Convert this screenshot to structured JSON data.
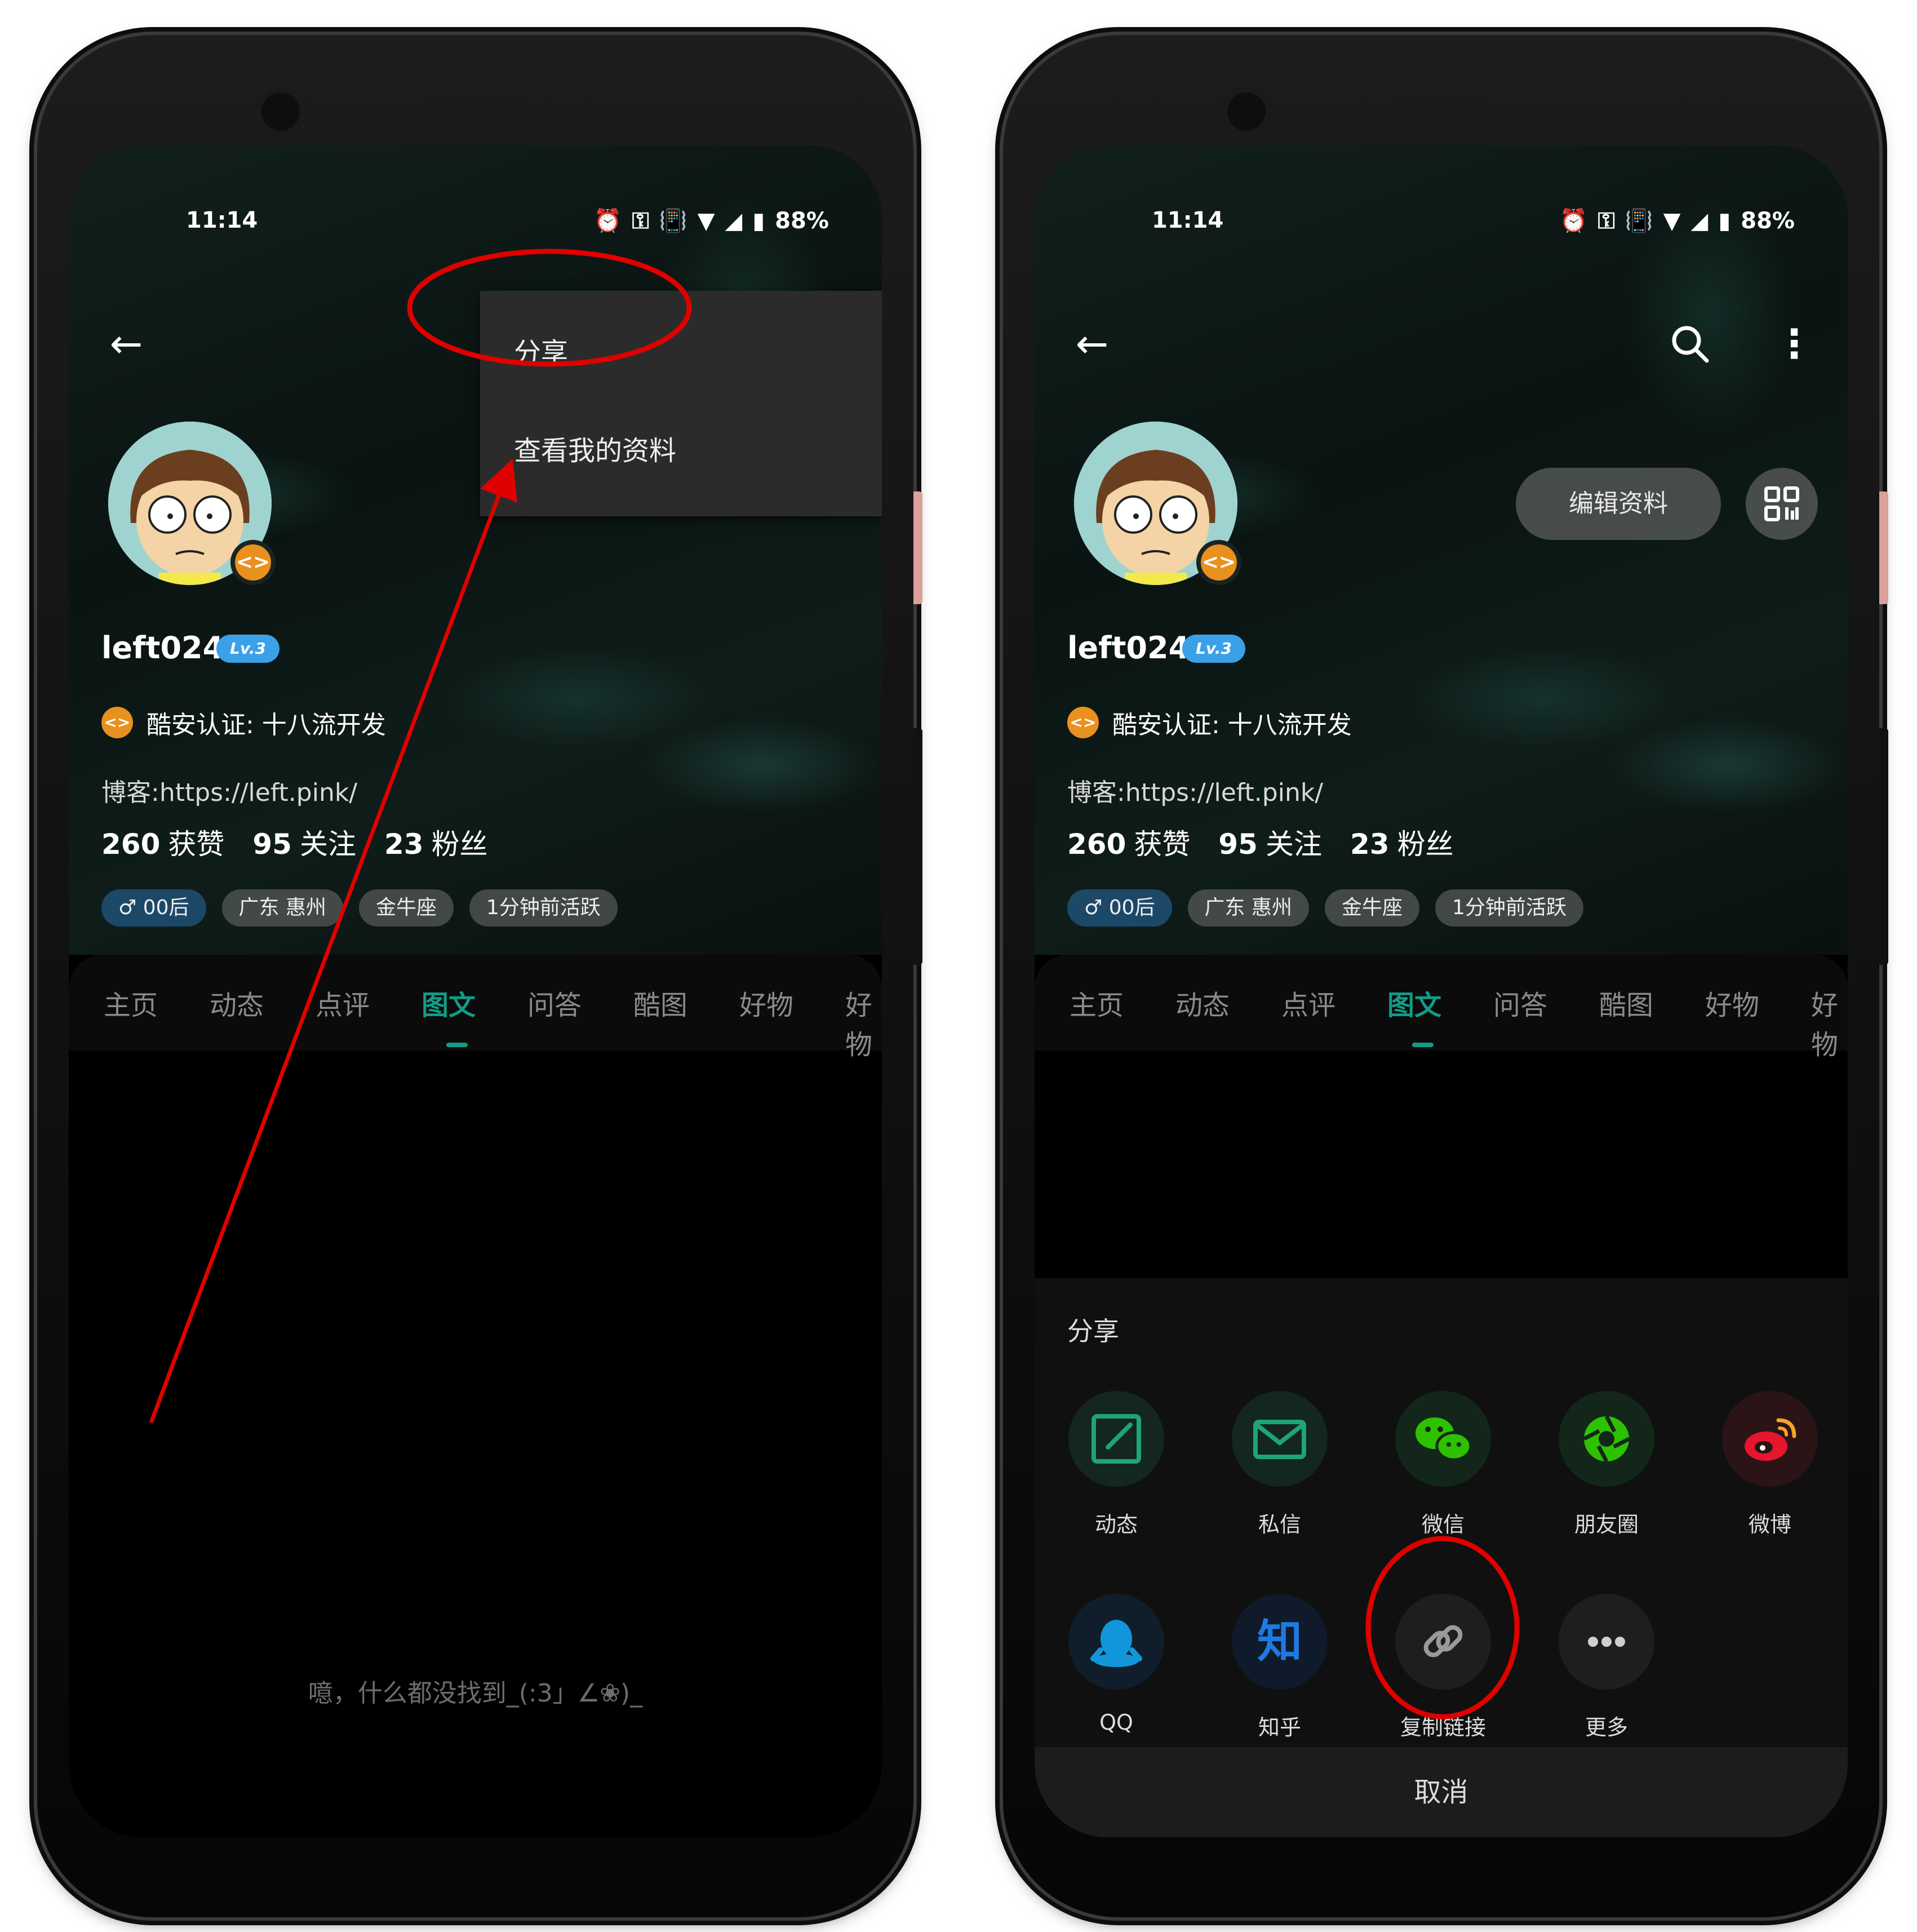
{
  "status_bar": {
    "time": "11:14",
    "battery": "88%"
  },
  "profile": {
    "username": "left024",
    "level": "Lv.3",
    "verification": "酷安认证: 十八流开发",
    "blog": "博客:https://left.pink/",
    "stats": [
      {
        "value": "260",
        "label": "获赞"
      },
      {
        "value": "95",
        "label": "关注"
      },
      {
        "value": "23",
        "label": "粉丝"
      }
    ],
    "tags": [
      "♂ 00后",
      "广东 惠州",
      "金牛座",
      "1分钟前活跃"
    ],
    "edit_button": "编辑资料"
  },
  "tabs": [
    "主页",
    "动态",
    "点评",
    "图文",
    "问答",
    "酷图",
    "好物",
    "好物"
  ],
  "active_tab": "图文",
  "empty_state": "噫，什么都没找到_(:3」∠❀)_",
  "overflow_menu": {
    "items": [
      "分享",
      "查看我的资料"
    ]
  },
  "share_sheet": {
    "title": "分享",
    "row1": [
      {
        "label": "动态",
        "icon": "edit-icon",
        "color": "#1fa37a"
      },
      {
        "label": "私信",
        "icon": "mail-icon",
        "color": "#1fa37a"
      },
      {
        "label": "微信",
        "icon": "wechat-icon",
        "color": "#2dc100"
      },
      {
        "label": "朋友圈",
        "icon": "moments-icon",
        "color": "#2dc100"
      },
      {
        "label": "微博",
        "icon": "weibo-icon",
        "color": "#e6162d"
      }
    ],
    "row2": [
      {
        "label": "QQ",
        "icon": "qq-icon",
        "color": "#1296db"
      },
      {
        "label": "知乎",
        "icon": "zhihu-icon",
        "glyph": "知",
        "color": "#0a66c2"
      },
      {
        "label": "复制链接",
        "icon": "link-icon",
        "color": "#9a9a9a"
      },
      {
        "label": "更多",
        "icon": "more-dots-icon",
        "color": "#cfcfcf"
      }
    ],
    "cancel": "取消"
  },
  "annotation_colors": {
    "highlight": "#e00000"
  }
}
